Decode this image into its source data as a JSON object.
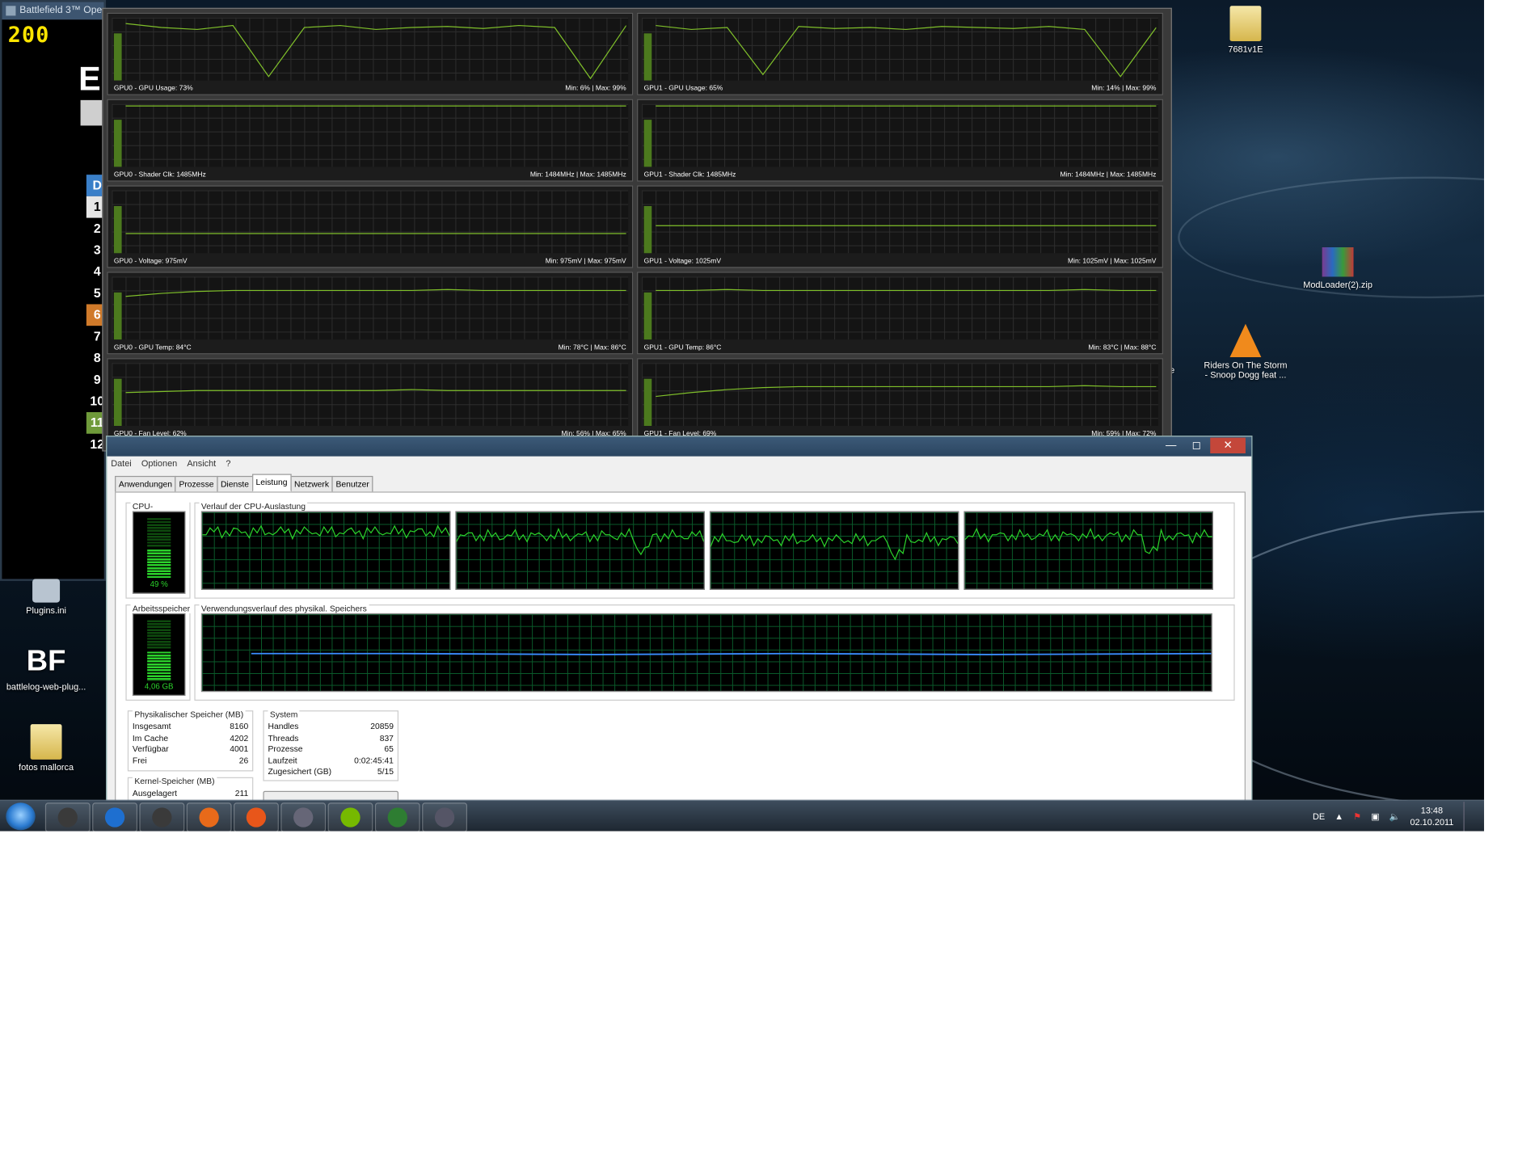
{
  "game_window": {
    "title": "Battlefield 3™ Ope",
    "fps": "200",
    "letter": "E",
    "numbers": [
      "D",
      "1",
      "2",
      "3",
      "4",
      "5",
      "6",
      "7",
      "8",
      "9",
      "10",
      "11",
      "12"
    ]
  },
  "gpu_monitor": {
    "panels": [
      {
        "label": "GPU0 - GPU Usage: 73%",
        "minmax": "Min: 6% | Max: 99%"
      },
      {
        "label": "GPU1 - GPU Usage: 65%",
        "minmax": "Min: 14% | Max: 99%"
      },
      {
        "label": "GPU0 - Shader Clk: 1485MHz",
        "minmax": "Min: 1484MHz | Max: 1485MHz"
      },
      {
        "label": "GPU1 - Shader Clk: 1485MHz",
        "minmax": "Min: 1484MHz | Max: 1485MHz"
      },
      {
        "label": "GPU0 - Voltage: 975mV",
        "minmax": "Min: 975mV | Max: 975mV"
      },
      {
        "label": "GPU1 - Voltage: 1025mV",
        "minmax": "Min: 1025mV | Max: 1025mV"
      },
      {
        "label": "GPU0 - GPU Temp: 84°C",
        "minmax": "Min: 78°C | Max: 86°C"
      },
      {
        "label": "GPU1 - GPU Temp: 86°C",
        "minmax": "Min: 83°C | Max: 88°C"
      },
      {
        "label": "GPU0 - Fan Level: 62%",
        "minmax": "Min: 56% | Max: 65%"
      },
      {
        "label": "GPU1 - Fan Level: 69%",
        "minmax": "Min: 59% | Max: 72%"
      }
    ]
  },
  "task_manager": {
    "menu": [
      "Datei",
      "Optionen",
      "Ansicht",
      "?"
    ],
    "tabs": [
      "Anwendungen",
      "Prozesse",
      "Dienste",
      "Leistung",
      "Netzwerk",
      "Benutzer"
    ],
    "active_tab": "Leistung",
    "cpu": {
      "title": "CPU-Auslastung",
      "value": "49 %",
      "history_title": "Verlauf der CPU-Auslastung"
    },
    "memory": {
      "title": "Arbeitsspeicher",
      "value": "4,06 GB",
      "history_title": "Verwendungsverlauf des physikal. Speichers"
    },
    "physical": {
      "title": "Physikalischer Speicher (MB)",
      "rows": [
        {
          "k": "Insgesamt",
          "v": "8160"
        },
        {
          "k": "Im Cache",
          "v": "4202"
        },
        {
          "k": "Verfügbar",
          "v": "4001"
        },
        {
          "k": "Frei",
          "v": "26"
        }
      ]
    },
    "system": {
      "title": "System",
      "rows": [
        {
          "k": "Handles",
          "v": "20859"
        },
        {
          "k": "Threads",
          "v": "837"
        },
        {
          "k": "Prozesse",
          "v": "65"
        },
        {
          "k": "Laufzeit",
          "v": "0:02:45:41"
        },
        {
          "k": "Zugesichert (GB)",
          "v": "5/15"
        }
      ]
    },
    "kernel": {
      "title": "Kernel-Speicher (MB)",
      "rows": [
        {
          "k": "Ausgelagert",
          "v": "211"
        }
      ]
    }
  },
  "desktop_icons": {
    "folder_7681": "7681v1E",
    "modloader": "ModLoader(2).zip",
    "riders": "Riders On The Storm - Snoop Dogg feat ...",
    "plugins": "Plugins.ini",
    "battlelog": "battlelog-web-plug...",
    "bf_logo": "BF",
    "fotos": "fotos mallorca",
    "partial": "ke"
  },
  "taskbar": {
    "apps": [
      "steam-icon",
      "ie-icon",
      "steam-icon",
      "firefox-icon",
      "origin-icon",
      "game-icon",
      "nvidia-icon",
      "monitor-icon",
      "app-icon"
    ],
    "language": "DE",
    "time": "13:48",
    "date": "02.10.2011"
  }
}
